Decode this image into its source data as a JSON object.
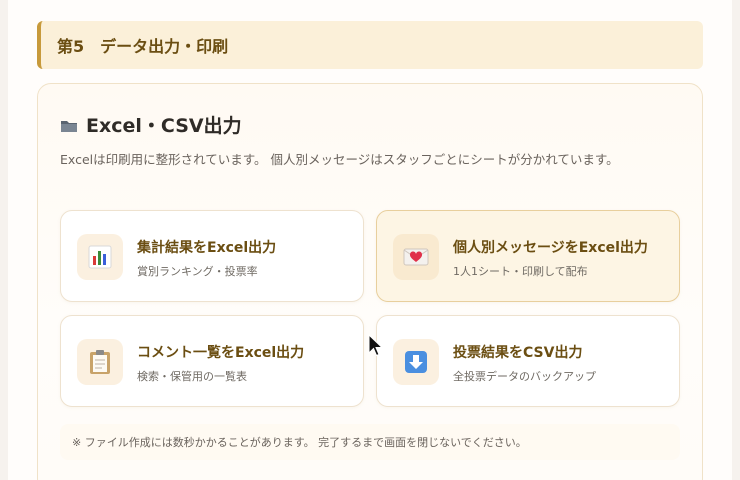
{
  "section": {
    "title": "第5　データ出力・印刷"
  },
  "card": {
    "title": "Excel・CSV出力",
    "icon": "folder-icon",
    "description": "Excelは印刷用に整形されています。 個人別メッセージはスタッフごとにシートが分かれています。"
  },
  "buttons": [
    {
      "title": "集計結果をExcel出力",
      "subtitle": "賞別ランキング・投票率",
      "icon": "bar-chart-icon"
    },
    {
      "title": "個人別メッセージをExcel出力",
      "subtitle": "1人1シート・印刷して配布",
      "icon": "envelope-heart-icon"
    },
    {
      "title": "コメント一覧をExcel出力",
      "subtitle": "検索・保管用の一覧表",
      "icon": "clipboard-icon"
    },
    {
      "title": "投票結果をCSV出力",
      "subtitle": "全投票データのバックアップ",
      "icon": "download-arrow-icon"
    }
  ],
  "note": "※ ファイル作成には数秒かかることがあります。 完了するまで画面を閉じないでください。",
  "colors": {
    "accent": "#c79a3b",
    "header_bg": "#fbf0d9",
    "title_brown": "#6b4e12"
  }
}
